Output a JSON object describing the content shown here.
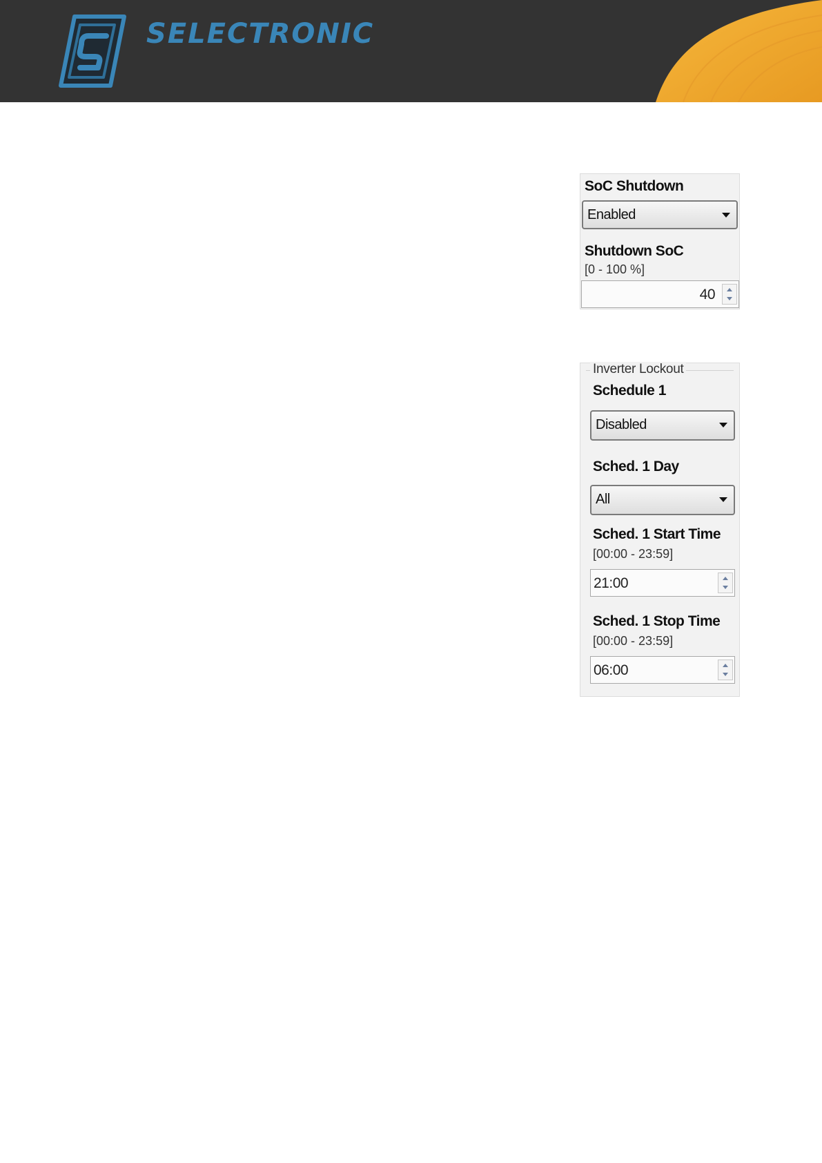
{
  "brand": {
    "name": "SELECTRONIC",
    "logo_icon": "selectronic-logo-icon",
    "colors": {
      "banner": "#333333",
      "accent_blue": "#3a86b8",
      "accent_orange": "#f0a830"
    }
  },
  "soc_panel": {
    "soc_shutdown_label": "SoC Shutdown",
    "soc_shutdown_value": "Enabled",
    "shutdown_soc_label": "Shutdown SoC",
    "shutdown_soc_range": "[0 - 100 %]",
    "shutdown_soc_value": "40"
  },
  "lockout_panel": {
    "group_title": "Inverter Lockout",
    "schedule_label": "Schedule 1",
    "schedule_value": "Disabled",
    "day_label": "Sched. 1 Day",
    "day_value": "All",
    "start_label": "Sched. 1 Start Time",
    "start_range": "[00:00 - 23:59]",
    "start_value": "21:00",
    "stop_label": "Sched. 1 Stop Time",
    "stop_range": "[00:00 - 23:59]",
    "stop_value": "06:00"
  }
}
